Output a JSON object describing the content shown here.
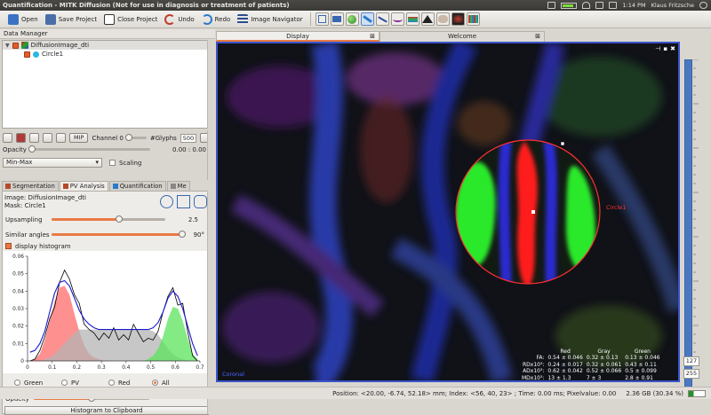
{
  "window": {
    "title": "Quantification - MITK Diffusion (Not for use in diagnosis or treatment of patients)",
    "clock": "1:14 PM",
    "user": "Klaus Fritzsche"
  },
  "toolbar": {
    "open": "Open",
    "save_project": "Save Project",
    "close_project": "Close Project",
    "undo": "Undo",
    "redo": "Redo",
    "image_navigator": "Image Navigator"
  },
  "data_manager": {
    "title": "Data Manager",
    "nodes": [
      {
        "label": "DiffusionImage_dti",
        "level": 0
      },
      {
        "label": "Circle1",
        "level": 1
      }
    ]
  },
  "properties": {
    "mip_label": "MIP",
    "channel_label": "Channel 0",
    "glyphs_label": "#Glyphs",
    "glyphs_value": "500",
    "opacity_label": "Opacity",
    "opacity_range": "0.00 : 0.00",
    "minmax_value": "Min-Max",
    "scaling_label": "Scaling"
  },
  "tabs": [
    {
      "label": "Segmentation",
      "color": "#c0392b"
    },
    {
      "label": "PV Analysis",
      "color": "#c0392b"
    },
    {
      "label": "Quantification",
      "color": "#2a7bc9"
    },
    {
      "label": "Me",
      "color": "#888888"
    }
  ],
  "pv_analysis": {
    "image_label": "Image:",
    "image_value": "DiffusionImage_dti",
    "mask_label": "Mask:",
    "mask_value": "Circle1",
    "upsampling_label": "Upsampling",
    "upsampling_value": "2.5",
    "upsampling_fraction": 0.59,
    "similar_angles_label": "Similar angles",
    "similar_angles_value": "90°",
    "similar_angles_fraction": 0.99,
    "display_histogram_label": "display histogram",
    "radio_options": [
      "Green",
      "PV",
      "Red",
      "All"
    ],
    "opacity_label": "Opacity",
    "opacity_fraction": 0.5,
    "clipboard_button": "Histogram to Clipboard"
  },
  "chart_data": {
    "type": "line",
    "title": "",
    "xlabel": "",
    "ylabel": "",
    "xlim": [
      0,
      0.7
    ],
    "ylim": [
      0,
      0.06
    ],
    "x_ticks": [
      "0",
      "0.1",
      "0.2",
      "0.3",
      "0.4",
      "0.5",
      "0.6",
      "0.7"
    ],
    "y_ticks": [
      "0",
      "0.01",
      "0.02",
      "0.03",
      "0.04",
      "0.05",
      "0.06"
    ],
    "x": [
      0.01,
      0.03,
      0.05,
      0.07,
      0.09,
      0.11,
      0.13,
      0.15,
      0.17,
      0.19,
      0.21,
      0.23,
      0.25,
      0.27,
      0.29,
      0.31,
      0.33,
      0.35,
      0.37,
      0.39,
      0.41,
      0.43,
      0.45,
      0.47,
      0.49,
      0.51,
      0.53,
      0.55,
      0.57,
      0.59,
      0.61,
      0.63,
      0.65,
      0.67,
      0.69
    ],
    "series": [
      {
        "color": "#000000",
        "values": [
          0.0,
          0.001,
          0.006,
          0.014,
          0.024,
          0.031,
          0.045,
          0.052,
          0.047,
          0.038,
          0.033,
          0.021,
          0.018,
          0.016,
          0.012,
          0.016,
          0.013,
          0.019,
          0.012,
          0.015,
          0.012,
          0.021,
          0.016,
          0.011,
          0.013,
          0.012,
          0.017,
          0.028,
          0.037,
          0.042,
          0.032,
          0.033,
          0.017,
          0.003,
          0.0
        ]
      },
      {
        "color": "#1a1acc",
        "values": [
          0.005,
          0.006,
          0.01,
          0.017,
          0.028,
          0.039,
          0.045,
          0.046,
          0.043,
          0.036,
          0.029,
          0.024,
          0.021,
          0.019,
          0.018,
          0.018,
          0.018,
          0.018,
          0.018,
          0.018,
          0.018,
          0.018,
          0.018,
          0.018,
          0.018,
          0.019,
          0.022,
          0.028,
          0.036,
          0.04,
          0.037,
          0.03,
          0.02,
          0.01,
          0.003
        ]
      },
      {
        "color": "#ff6b6b",
        "fill": true,
        "values": [
          0.0,
          0.001,
          0.004,
          0.012,
          0.023,
          0.034,
          0.042,
          0.043,
          0.038,
          0.027,
          0.017,
          0.009,
          0.004,
          0.002,
          0.001,
          0.0,
          0.0,
          0.0,
          0.0,
          0.0,
          0.0,
          0.0,
          0.0,
          0.0,
          0.0,
          0.0,
          0.0,
          0.0,
          0.0,
          0.0,
          0.0,
          0.0,
          0.0,
          0.0,
          0.0
        ]
      },
      {
        "color": "#b4b4b4",
        "fill": true,
        "values": [
          0.0,
          0.0,
          0.0,
          0.001,
          0.002,
          0.004,
          0.007,
          0.01,
          0.013,
          0.016,
          0.018,
          0.018,
          0.018,
          0.018,
          0.018,
          0.018,
          0.018,
          0.018,
          0.018,
          0.018,
          0.018,
          0.018,
          0.018,
          0.018,
          0.018,
          0.017,
          0.015,
          0.011,
          0.007,
          0.004,
          0.002,
          0.001,
          0.0,
          0.0,
          0.0
        ]
      },
      {
        "color": "#5be35b",
        "fill": true,
        "values": [
          0.0,
          0.0,
          0.0,
          0.0,
          0.0,
          0.0,
          0.0,
          0.0,
          0.0,
          0.0,
          0.0,
          0.0,
          0.0,
          0.0,
          0.0,
          0.0,
          0.0,
          0.0,
          0.0,
          0.0,
          0.0,
          0.0,
          0.0,
          0.0,
          0.001,
          0.003,
          0.007,
          0.014,
          0.024,
          0.031,
          0.03,
          0.023,
          0.013,
          0.004,
          0.001
        ]
      }
    ]
  },
  "views": {
    "display_tab": "Display",
    "welcome_tab": "Welcome",
    "orientation_label": "Coronal",
    "roi_label": "Circle1"
  },
  "stats_table": {
    "headers": [
      "",
      "Red",
      "Gray",
      "Green"
    ],
    "rows": [
      [
        "FA:",
        "0.54 ± 0.046",
        "0.32 ± 0.13",
        "0.13 ± 0.046"
      ],
      [
        "RDx10³:",
        "0.24 ± 0.017",
        "0.32 ± 0.061",
        "0.43 ± 0.11"
      ],
      [
        "ADx10³:",
        "0.62 ± 0.042",
        "0.52 ± 0.066",
        "0.5 ± 0.099"
      ],
      [
        "MDx10³:",
        "13 ± 1.3",
        "7 ± 3",
        "2.8 ± 0.91"
      ]
    ]
  },
  "level_window": {
    "level": "127",
    "window": "255"
  },
  "statusbar": {
    "position_text": "Position: <20.00, -6.74, 52.18> mm; Index: <56, 40, 23> ; Time: 0.00 ms; Pixelvalue: 0.00",
    "memory": "2.36 GB (30.34 %)"
  }
}
